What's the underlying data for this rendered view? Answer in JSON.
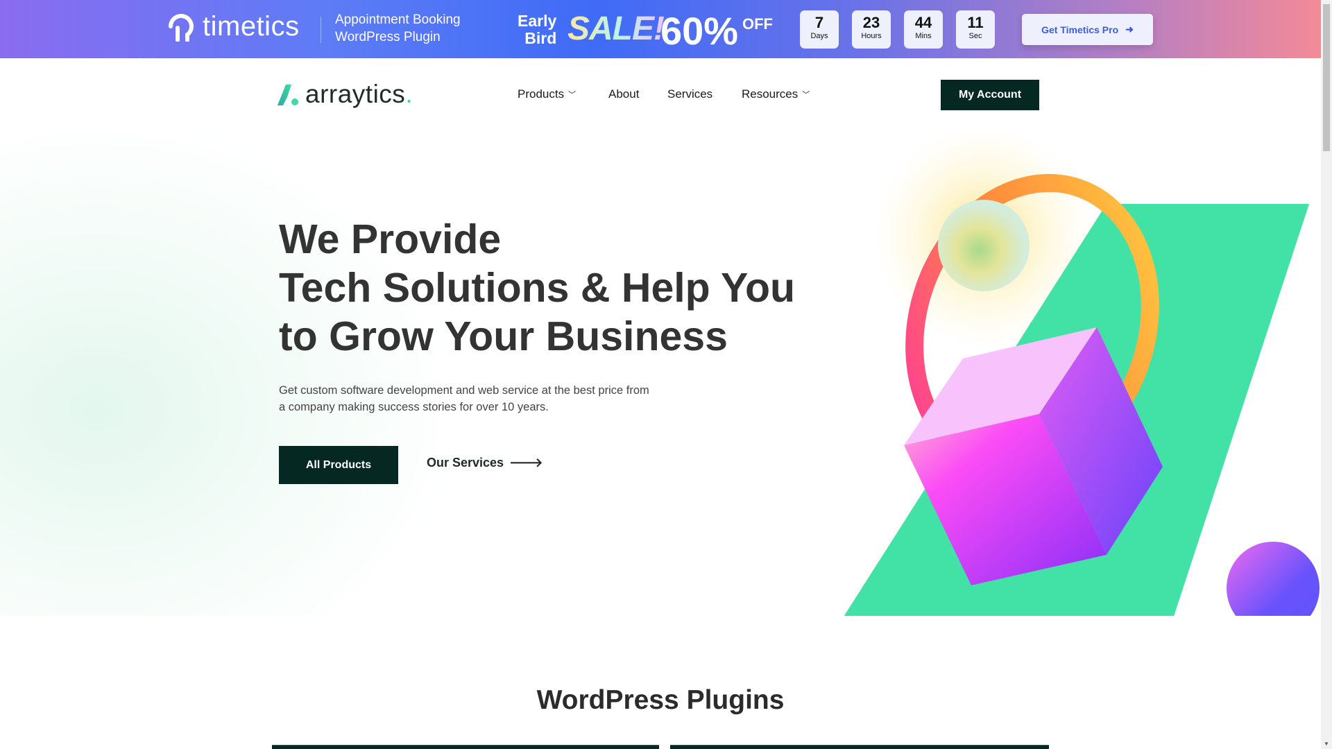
{
  "promo": {
    "brand": "timetics",
    "tagline_line1": "Appointment Booking",
    "tagline_line2": "WordPress Plugin",
    "early_line1": "Early",
    "early_line2": "Bird",
    "sale": "SALE!",
    "discount": "60%",
    "off": "OFF",
    "countdown": [
      {
        "value": "7",
        "unit": "Days"
      },
      {
        "value": "23",
        "unit": "Hours"
      },
      {
        "value": "44",
        "unit": "Mins"
      },
      {
        "value": "11",
        "unit": "Sec"
      }
    ],
    "cta": "Get Timetics Pro"
  },
  "nav": {
    "logo": "arraytics",
    "logo_dot": ".",
    "items": [
      {
        "label": "Products",
        "dropdown": true
      },
      {
        "label": "About"
      },
      {
        "label": "Services"
      },
      {
        "label": "Resources",
        "dropdown": true
      }
    ],
    "account": "My Account"
  },
  "hero": {
    "title_line1": "We Provide",
    "title_line2": "Tech Solutions & Help You",
    "title_line3": "to Grow Your Business",
    "desc_line1": "Get custom software development and web service at the best price from",
    "desc_line2": "a company making success stories for over 10 years.",
    "primary": "All Products",
    "secondary": "Our Services"
  },
  "section": {
    "title": "WordPress Plugins"
  },
  "colors": {
    "dark": "#062823",
    "accent": "#42e1a6",
    "link": "#3b5bdb"
  }
}
